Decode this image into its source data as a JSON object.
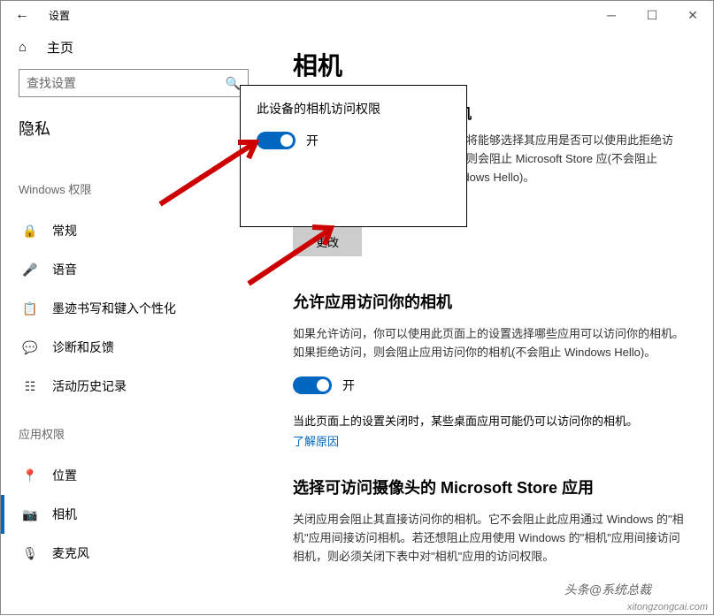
{
  "window": {
    "title": "设置"
  },
  "sidebar": {
    "home": "主页",
    "search_placeholder": "查找设置",
    "privacy": "隐私",
    "group1": "Windows 权限",
    "items1": [
      {
        "label": "常规"
      },
      {
        "label": "语音"
      },
      {
        "label": "墨迹书写和键入个性化"
      },
      {
        "label": "诊断和反馈"
      },
      {
        "label": "活动历史记录"
      }
    ],
    "group2": "应用权限",
    "items2": [
      {
        "label": "位置"
      },
      {
        "label": "相机"
      },
      {
        "label": "麦克风"
      }
    ]
  },
  "main": {
    "title": "相机",
    "sec1_title": "相机",
    "sec1_desc": "用户将能够选择其应用是否可以使用此拒绝访问，则会阻止 Microsoft Store 应(不会阻止 Windows Hello)。",
    "change_btn": "更改",
    "sec2_title": "允许应用访问你的相机",
    "sec2_desc": "如果允许访问，你可以使用此页面上的设置选择哪些应用可以访问你的相机。如果拒绝访问，则会阻止应用访问你的相机(不会阻止 Windows Hello)。",
    "toggle_on": "开",
    "note": "当此页面上的设置关闭时，某些桌面应用可能仍可以访问你的相机。",
    "link": "了解原因",
    "sec3_title": "选择可访问摄像头的 Microsoft Store 应用",
    "sec3_desc": "关闭应用会阻止其直接访问你的相机。它不会阻止此应用通过 Windows 的\"相机\"应用间接访问相机。若还想阻止应用使用 Windows 的\"相机\"应用间接访问相机，则必须关闭下表中对\"相机\"应用的访问权限。"
  },
  "popup": {
    "title": "此设备的相机访问权限",
    "toggle_on": "开"
  },
  "watermark": {
    "tag": "头条@系统总裁",
    "url": "xitongzongcai.com"
  }
}
